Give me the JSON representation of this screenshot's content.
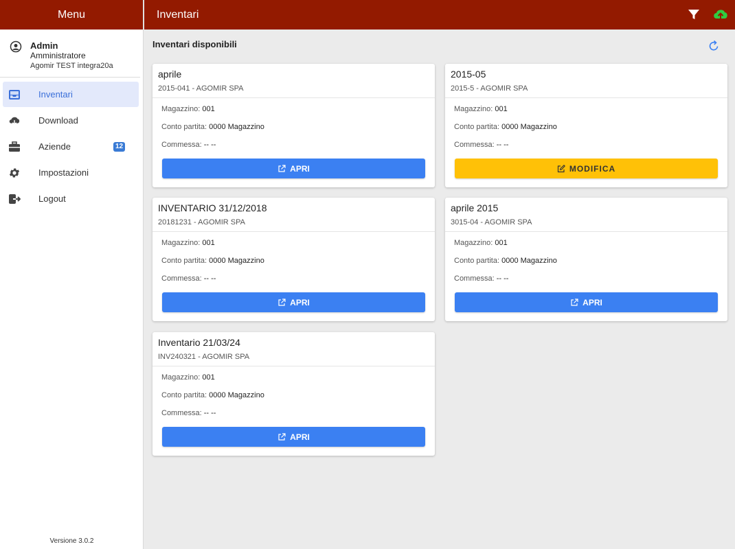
{
  "sidebar": {
    "title": "Menu",
    "profile": {
      "name": "Admin",
      "role": "Amministratore",
      "company": "Agomir TEST integra20a"
    },
    "items": [
      {
        "label": "Inventari",
        "icon": "inbox-icon"
      },
      {
        "label": "Download",
        "icon": "cloud-download-icon"
      },
      {
        "label": "Aziende",
        "icon": "briefcase-icon",
        "badge": "12"
      },
      {
        "label": "Impostazioni",
        "icon": "gear-icon"
      },
      {
        "label": "Logout",
        "icon": "logout-icon"
      }
    ],
    "version": "Versione 3.0.2"
  },
  "topbar": {
    "title": "Inventari"
  },
  "content": {
    "section_title": "Inventari disponibili",
    "labels": {
      "magazzino": "Magazzino:",
      "conto": "Conto partita:",
      "commessa": "Commessa:"
    },
    "cards": [
      {
        "title": "aprile",
        "subtitle": "2015-041 - AGOMIR SPA",
        "magazzino": "001",
        "conto": "0000 Magazzino",
        "commessa": "-- --",
        "button": "APRI",
        "button_type": "open"
      },
      {
        "title": "2015-05",
        "subtitle": "2015-5 - AGOMIR SPA",
        "magazzino": "001",
        "conto": "0000 Magazzino",
        "commessa": "-- --",
        "button": "MODIFICA",
        "button_type": "edit"
      },
      {
        "title": "INVENTARIO 31/12/2018",
        "subtitle": "20181231 - AGOMIR SPA",
        "magazzino": "001",
        "conto": "0000 Magazzino",
        "commessa": "-- --",
        "button": "APRI",
        "button_type": "open"
      },
      {
        "title": "aprile 2015",
        "subtitle": "3015-04 - AGOMIR SPA",
        "magazzino": "001",
        "conto": "0000 Magazzino",
        "commessa": "-- --",
        "button": "APRI",
        "button_type": "open"
      },
      {
        "title": "Inventario 21/03/24",
        "subtitle": "INV240321 - AGOMIR SPA",
        "magazzino": "001",
        "conto": "0000 Magazzino",
        "commessa": "-- --",
        "button": "APRI",
        "button_type": "open"
      }
    ]
  },
  "colors": {
    "header": "#931a00",
    "primary": "#3b80f2",
    "warning": "#ffc107",
    "upload": "#2ecc40"
  }
}
